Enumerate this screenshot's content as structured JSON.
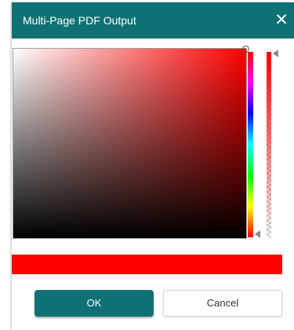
{
  "dialog": {
    "title": "Multi-Page PDF Output",
    "close_glyph": "✕",
    "close_icon": "close-icon"
  },
  "color_picker": {
    "current_color": "#ff0000",
    "hue_level": 0,
    "saturation": 1,
    "value": 1,
    "alpha": 1
  },
  "buttons": {
    "ok_label": "OK",
    "cancel_label": "Cancel"
  },
  "colors": {
    "accent": "#0f7173",
    "selected": "#ff0000"
  }
}
